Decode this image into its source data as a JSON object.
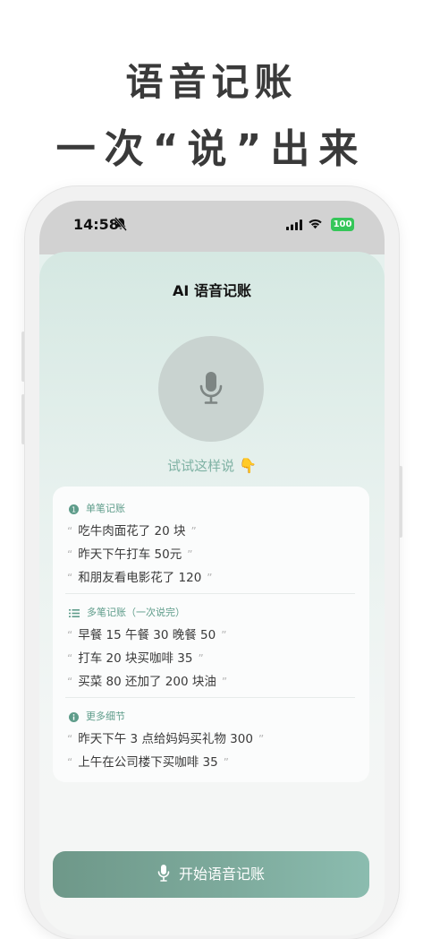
{
  "headline": {
    "line1": "语音记账",
    "line2": "一次“说”出来"
  },
  "status_bar": {
    "time": "14:58",
    "battery": "100",
    "icons": [
      "bell-slash-icon",
      "signal-icon",
      "wifi-icon",
      "battery-icon"
    ]
  },
  "screen": {
    "title": "AI 语音记账",
    "hint": "试试这样说",
    "hint_emoji": "👇",
    "sections": [
      {
        "icon": "number-one-icon",
        "title": "单笔记账",
        "examples": [
          "吃牛肉面花了 20 块",
          "昨天下午打车 50元",
          "和朋友看电影花了 120"
        ]
      },
      {
        "icon": "list-icon",
        "title": "多笔记账（一次说完）",
        "examples": [
          "早餐 15 午餐 30 晚餐 50",
          "打车 20 块买咖啡 35",
          "买菜 80 还加了 200 块油"
        ]
      },
      {
        "icon": "info-icon",
        "title": "更多细节",
        "examples": [
          "昨天下午 3 点给妈妈买礼物 300",
          "上午在公司楼下买咖啡 35"
        ]
      }
    ],
    "quote_open": "“",
    "quote_close": "”",
    "start_button": "开始语音记账"
  },
  "colors": {
    "accent": "#7daa9c",
    "hint_text": "#7fb2a4",
    "section_title": "#5e9c8a",
    "battery": "#35c659"
  }
}
